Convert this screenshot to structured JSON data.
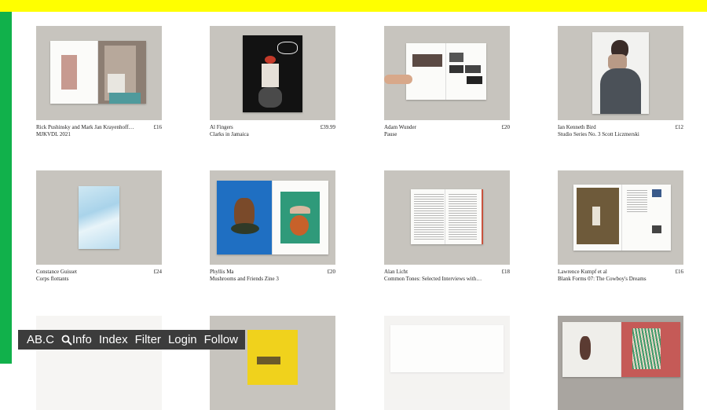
{
  "colors": {
    "top_bar": "#ffff00",
    "side_bar": "#11b14b",
    "nav_bg": "#3c3c3c"
  },
  "nav": {
    "logo": "AB.C",
    "search_icon": "search-icon",
    "items": [
      "Info",
      "Index",
      "Filter",
      "Login",
      "Follow"
    ]
  },
  "products": [
    {
      "author": "Rick Pushinsky and Mark Jan Krayenhoff van de Leur",
      "title": "MJKVDL 2021",
      "price": "£16"
    },
    {
      "author": "Al Fingers",
      "title": "Clarks in Jamaica",
      "price": "£39.99"
    },
    {
      "author": "Adam Wunder",
      "title": "Pause",
      "price": "£20"
    },
    {
      "author": "Ian Kenneth Bird",
      "title": "Studio Series No. 3 Scott Liczmerski",
      "price": "£12"
    },
    {
      "author": "Constance Guisset",
      "title": "Corps flottants",
      "price": "£24"
    },
    {
      "author": "Phyllis Ma",
      "title": "Mushrooms and Friends Zine 3",
      "price": "£20"
    },
    {
      "author": "Alan Licht",
      "title": "Common Tones: Selected Interviews with Artists and Musicians",
      "price": "£18"
    },
    {
      "author": "Lawrence Kumpf et al",
      "title": "Blank Forms 07: The Cowboy's Dreams",
      "price": "£16"
    }
  ]
}
